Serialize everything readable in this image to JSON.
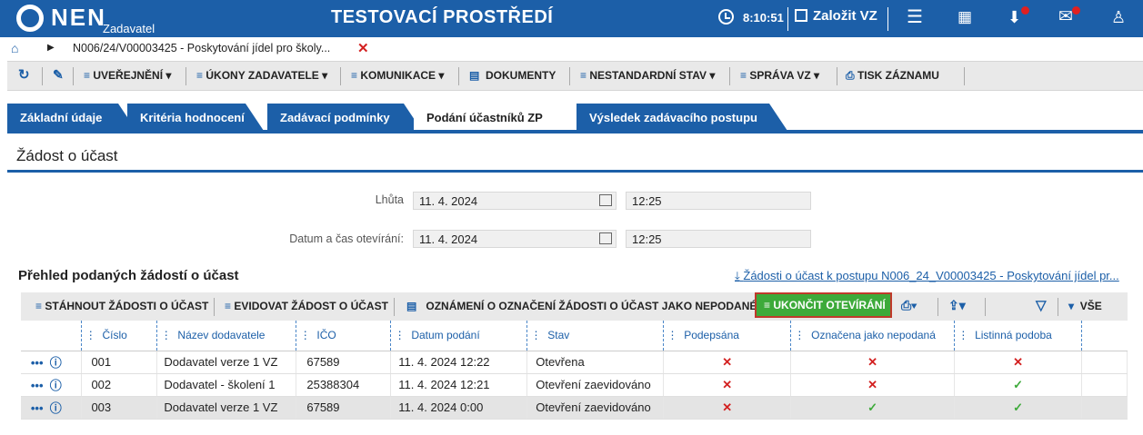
{
  "header": {
    "logo": "NEN",
    "logo_sub": "Zadavatel",
    "environment": "TESTOVACÍ PROSTŘEDÍ",
    "time": "8:10:51",
    "create_label": "Založit VZ",
    "icons": [
      "menu-icon",
      "calendar-icon",
      "inbox-icon",
      "mail-icon",
      "user-icon"
    ],
    "accent": "#1c5fa8"
  },
  "breadcrumb": {
    "text": "N006/24/V00003425 - Poskytování jídel pro školy..."
  },
  "actions": {
    "uverejneni": "UVEŘEJNĚNÍ",
    "ukony": "ÚKONY ZADAVATELE",
    "komunikace": "KOMUNIKACE",
    "dokumenty": "DOKUMENTY",
    "nestandardni": "NESTANDARDNÍ STAV",
    "sprava": "SPRÁVA VZ",
    "tisk": "TISK ZÁZNAMU"
  },
  "tabs": [
    "Základní údaje",
    "Kritéria hodnocení",
    "Zadávací podmínky",
    "Podání účastníků ZP",
    "Výsledek zadávacího postupu"
  ],
  "section_title": "Žádost o účast",
  "form": {
    "lhuta_label": "Lhůta",
    "lhuta_date": "11. 4. 2024",
    "lhuta_time": "12:25",
    "otevirani_label": "Datum a čas otevírání:",
    "otevirani_date": "11. 4. 2024",
    "otevirani_time": "12:25"
  },
  "overview": {
    "title": "Přehled podaných žádostí o účast",
    "link": "Žádosti o účast k postupu N006_24_V00003425 - Poskytování jídel pr..."
  },
  "grid_toolbar": {
    "stahnout": "STÁHNOUT ŽÁDOSTI O ÚČAST",
    "evidovat": "EVIDOVAT ŽÁDOST O ÚČAST",
    "oznameni": "OZNÁMENÍ O OZNAČENÍ ŽÁDOSTI O ÚČAST JAKO NEPODANÉ",
    "ukoncit": "UKONČIT OTEVÍRÁNÍ",
    "vse": "VŠE"
  },
  "table": {
    "columns": [
      "Číslo",
      "Název dodavatele",
      "IČO",
      "Datum podání",
      "Stav",
      "Podepsána",
      "Označena jako nepodaná",
      "Listinná podoba"
    ],
    "rows": [
      {
        "cislo": "001",
        "nazev": "Dodavatel verze 1 VZ",
        "ico": "67589",
        "datum": "11. 4. 2024 12:22",
        "stav": "Otevřena",
        "podepsana": "✕",
        "nepodana": "✕",
        "listinna": "✕"
      },
      {
        "cislo": "002",
        "nazev": "Dodavatel - školení 1",
        "ico": "25388304",
        "datum": "11. 4. 2024 12:21",
        "stav": "Otevření zaevidováno",
        "podepsana": "✕",
        "nepodana": "✕",
        "listinna": "✓"
      },
      {
        "cislo": "003",
        "nazev": "Dodavatel verze 1 VZ",
        "ico": "67589",
        "datum": "11. 4. 2024 0:00",
        "stav": "Otevření zaevidováno",
        "podepsana": "✕",
        "nepodana": "✓",
        "listinna": "✓"
      }
    ]
  }
}
